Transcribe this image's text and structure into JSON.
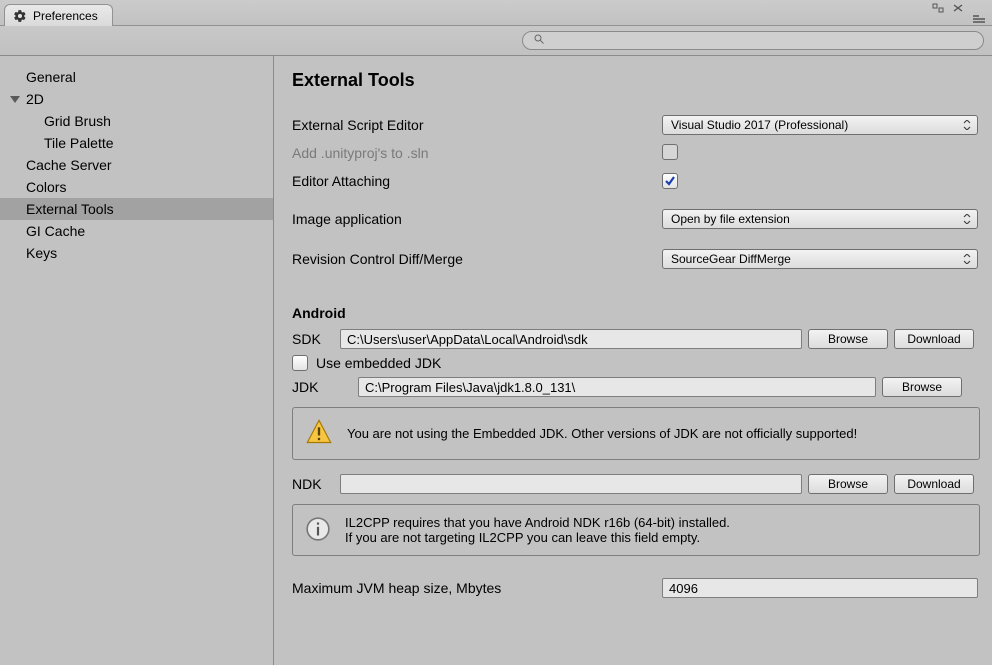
{
  "tab_title": "Preferences",
  "search_placeholder": "",
  "sidebar": {
    "items": [
      {
        "label": "General"
      },
      {
        "label": "2D"
      },
      {
        "label": "Grid Brush"
      },
      {
        "label": "Tile Palette"
      },
      {
        "label": "Cache Server"
      },
      {
        "label": "Colors"
      },
      {
        "label": "External Tools"
      },
      {
        "label": "GI Cache"
      },
      {
        "label": "Keys"
      }
    ]
  },
  "main": {
    "title": "External Tools",
    "rows": {
      "script_editor_label": "External Script Editor",
      "script_editor_value": "Visual Studio 2017 (Professional)",
      "add_unityproj_label": "Add .unityproj's to .sln",
      "editor_attaching_label": "Editor Attaching",
      "image_app_label": "Image application",
      "image_app_value": "Open by file extension",
      "revision_label": "Revision Control Diff/Merge",
      "revision_value": "SourceGear DiffMerge"
    },
    "android": {
      "heading": "Android",
      "sdk_label": "SDK",
      "sdk_value": "C:\\Users\\user\\AppData\\Local\\Android\\sdk",
      "browse_label": "Browse",
      "download_label": "Download",
      "use_embedded_label": "Use embedded JDK",
      "jdk_label": "JDK",
      "jdk_value": "C:\\Program Files\\Java\\jdk1.8.0_131\\",
      "warn_message": "You are not using the Embedded JDK. Other versions of JDK are not officially supported!",
      "ndk_label": "NDK",
      "ndk_value": "",
      "info_line1": "IL2CPP requires that you have Android NDK r16b (64-bit) installed.",
      "info_line2": "If you are not targeting IL2CPP you can leave this field empty.",
      "heap_label": "Maximum JVM heap size, Mbytes",
      "heap_value": "4096"
    }
  }
}
